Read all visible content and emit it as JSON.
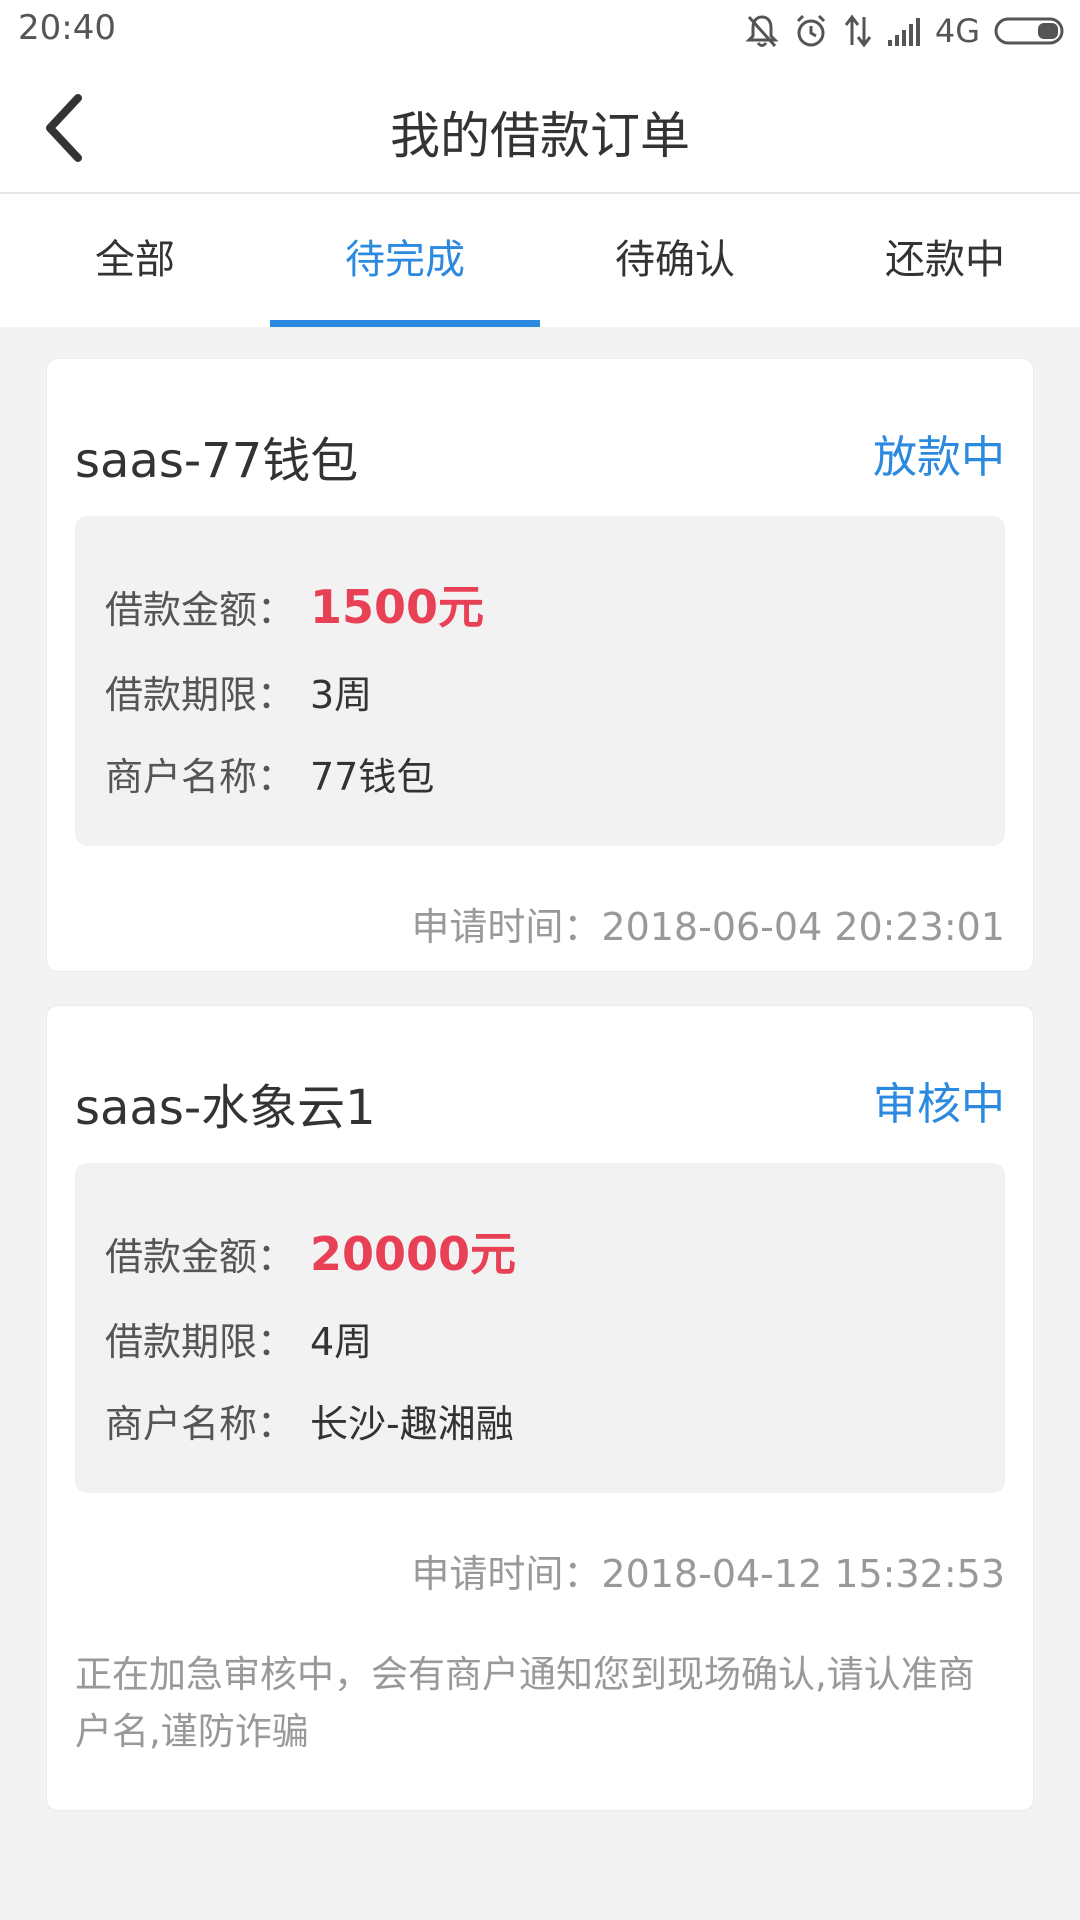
{
  "status_bar": {
    "time": "20:40",
    "network": "4G"
  },
  "header": {
    "title": "我的借款订单"
  },
  "tabs": [
    {
      "label": "全部",
      "active": false
    },
    {
      "label": "待完成",
      "active": true
    },
    {
      "label": "待确认",
      "active": false
    },
    {
      "label": "还款中",
      "active": false
    }
  ],
  "orders": [
    {
      "name": "saas-77钱包",
      "status": "放款中",
      "amount_label": "借款金额：",
      "amount": "1500元",
      "term_label": "借款期限：",
      "term": "3周",
      "merchant_label": "商户名称：",
      "merchant": "77钱包",
      "apply_time": "申请时间：2018-06-04 20:23:01"
    },
    {
      "name": "saas-水象云1",
      "status": "审核中",
      "amount_label": "借款金额：",
      "amount": "20000元",
      "term_label": "借款期限：",
      "term": "4周",
      "merchant_label": "商户名称：",
      "merchant": "长沙-趣湘融",
      "apply_time": "申请时间：2018-04-12 15:32:53",
      "notice": "正在加急审核中，会有商户通知您到现场确认,请认准商户名,谨防诈骗"
    }
  ],
  "colors": {
    "accent": "#2b8ae0",
    "amount": "#e84156",
    "background": "#f3f3f3"
  }
}
